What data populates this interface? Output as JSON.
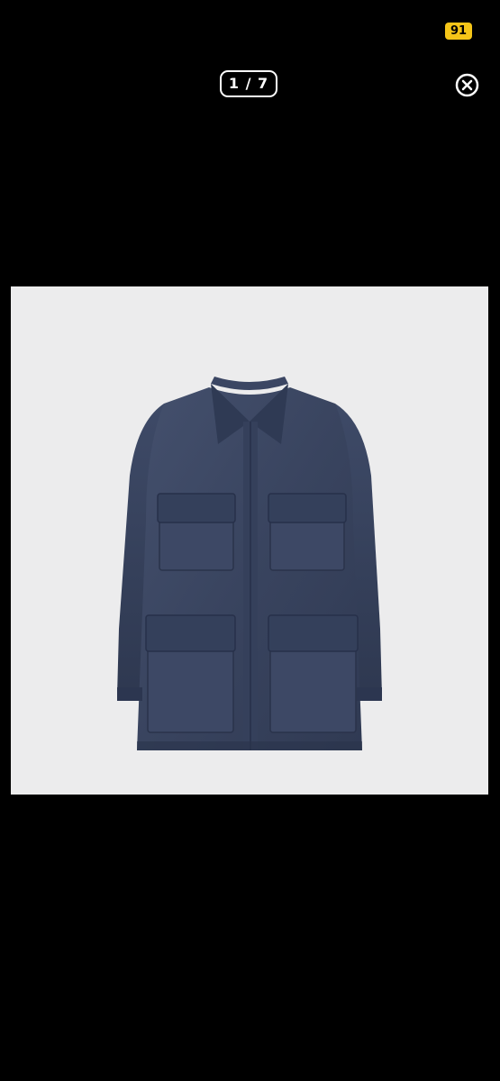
{
  "status_bar": {
    "badge": "91",
    "badge_color": "#f5c518"
  },
  "viewer": {
    "counter": "1 / 7",
    "close_icon": "close-circle-icon",
    "background": "#000000"
  },
  "photo": {
    "subject": "jacket-image",
    "background": "#ececed",
    "garment_color": "#3a4766"
  }
}
